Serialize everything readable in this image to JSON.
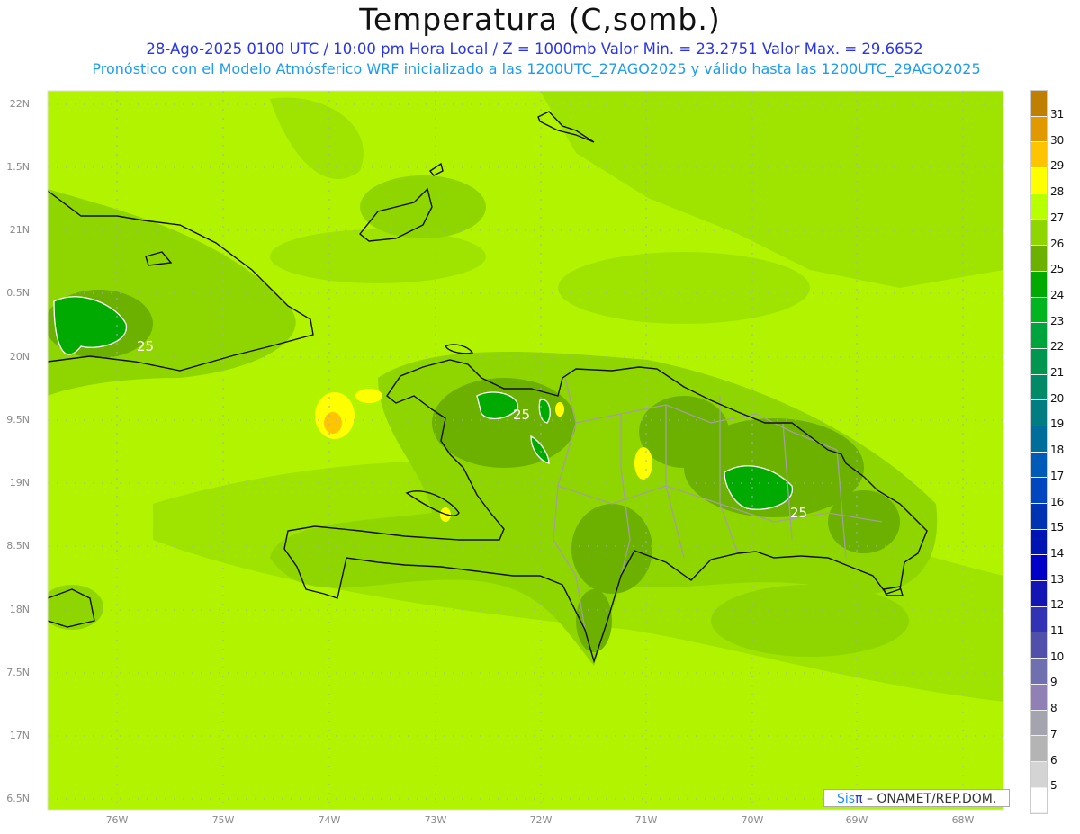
{
  "header": {
    "title": "Temperatura (C,somb.)",
    "subtitle": "28-Ago-2025 0100 UTC / 10:00 pm Hora Local / Z = 1000mb   Valor Min. = 23.2751   Valor Max. = 29.6652",
    "model_info": "Pronóstico con el Modelo Atmósferico WRF inicializado a las 1200UTC_27AGO2025 y válido hasta las  1200UTC_29AGO2025"
  },
  "axes": {
    "lat_labels": [
      "22N",
      "1.5N",
      "21N",
      "0.5N",
      "20N",
      "9.5N",
      "19N",
      "8.5N",
      "18N",
      "7.5N",
      "17N",
      "6.5N"
    ],
    "lon_labels": [
      "76W",
      "75W",
      "74W",
      "73W",
      "72W",
      "71W",
      "70W",
      "69W",
      "68W"
    ]
  },
  "contour_labels": [
    "25",
    "25",
    "25"
  ],
  "colorbar": {
    "labels": [
      "31",
      "30",
      "29",
      "28",
      "27",
      "26",
      "25",
      "24",
      "23",
      "22",
      "21",
      "20",
      "19",
      "18",
      "17",
      "16",
      "15",
      "14",
      "13",
      "12",
      "11",
      "10",
      "9",
      "8",
      "7",
      "6",
      "5"
    ],
    "colors": [
      "#bf7f00",
      "#e09a00",
      "#ffc400",
      "#ffff00",
      "#b8ff00",
      "#8fd600",
      "#6cb000",
      "#00aa00",
      "#00b520",
      "#00a43c",
      "#009650",
      "#008a68",
      "#007d80",
      "#006e9b",
      "#005ab8",
      "#0046c0",
      "#0032b4",
      "#0014b4",
      "#0000c8",
      "#1414b4",
      "#3232b4",
      "#5050aa",
      "#7070b0",
      "#9080b4",
      "#a4a4ae",
      "#b4b4b4",
      "#d4d4d4",
      "#ffffff"
    ]
  },
  "credit": {
    "sis": "Sis",
    "pi": "π",
    "rest": " –  ONAMET/REP.DOM."
  }
}
